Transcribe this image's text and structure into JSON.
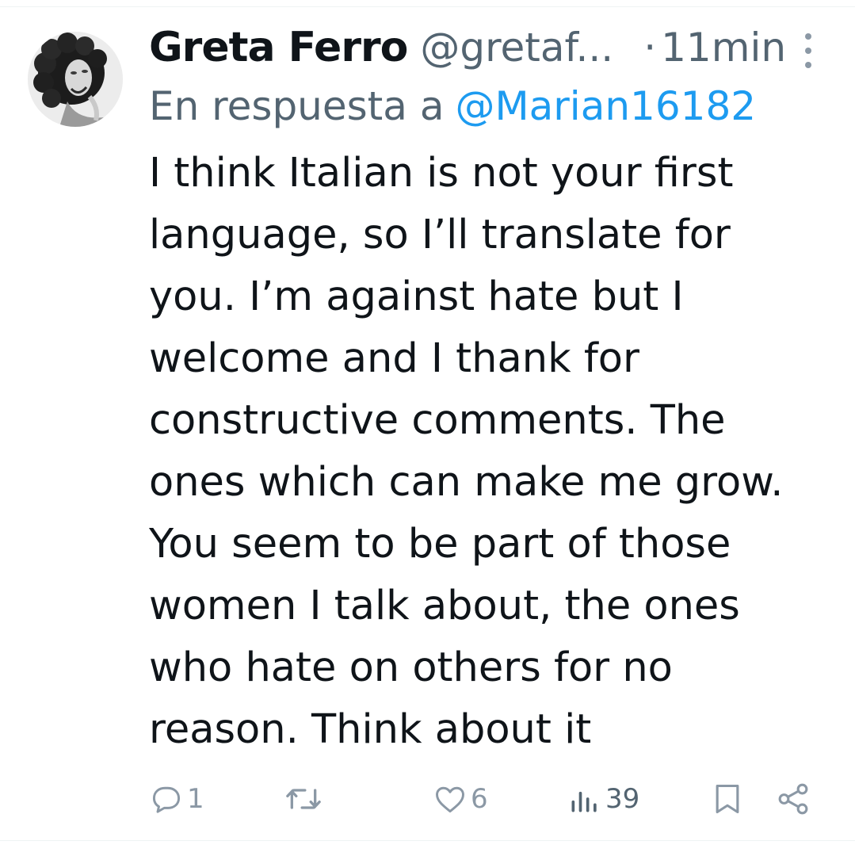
{
  "tweet": {
    "author_name": "Greta Ferro",
    "author_handle": "@gretaf...",
    "separator": "·",
    "time": "11min",
    "reply_prefix": "En respuesta a",
    "reply_to": "@Marian16182",
    "lines": [
      "I think Italian is not your first",
      "language, so I’ll translate for",
      "you. I’m against hate but I",
      "welcome and I thank for",
      "constructive comments. The",
      "ones which can make me grow.",
      "You seem to be part of those",
      "women I talk about, the ones",
      "who hate on others for no",
      "reason. Think about it"
    ]
  },
  "actions": {
    "reply": {
      "icon": "reply-icon",
      "count": "1"
    },
    "retweet": {
      "icon": "retweet-icon"
    },
    "like": {
      "icon": "heart-icon",
      "count": "6"
    },
    "views": {
      "icon": "views-icon",
      "count": "39"
    },
    "bookmark": {
      "icon": "bookmark-icon"
    },
    "share": {
      "icon": "share-icon"
    }
  },
  "colors": {
    "text": "#0f1419",
    "muted": "#536471",
    "link": "#1d9bf0",
    "icon": "#8b98a5"
  }
}
